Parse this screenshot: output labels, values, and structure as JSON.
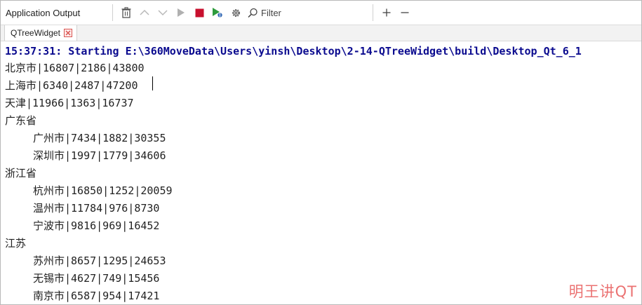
{
  "toolbar": {
    "title": "Application Output",
    "filter_placeholder": "Filter",
    "icons": [
      "trash-icon",
      "arrow-up-icon",
      "arrow-down-icon",
      "run-icon",
      "stop-icon",
      "debug-run-icon",
      "gear-icon",
      "search-icon",
      "plus-icon",
      "minus-icon"
    ],
    "stop_color": "#c8102e",
    "debug_color": "#2e9b3c"
  },
  "tab": {
    "label": "QTreeWidget"
  },
  "output": {
    "start_line": "15:37:31: Starting E:\\360MoveData\\Users\\yinsh\\Desktop\\2-14-QTreeWidget\\build\\Desktop_Qt_6_1",
    "lines": [
      {
        "text": "北京市|16807|2186|43800",
        "indent": false
      },
      {
        "text": "上海市|6340|2487|47200",
        "indent": false
      },
      {
        "text": "天津|11966|1363|16737",
        "indent": false
      },
      {
        "text": "广东省",
        "indent": false
      },
      {
        "text": "广州市|7434|1882|30355",
        "indent": true
      },
      {
        "text": "深圳市|1997|1779|34606",
        "indent": true
      },
      {
        "text": "浙江省",
        "indent": false
      },
      {
        "text": "杭州市|16850|1252|20059",
        "indent": true
      },
      {
        "text": "温州市|11784|976|8730",
        "indent": true
      },
      {
        "text": "宁波市|9816|969|16452",
        "indent": true
      },
      {
        "text": "江苏",
        "indent": false
      },
      {
        "text": "苏州市|8657|1295|24653",
        "indent": true
      },
      {
        "text": "无锡市|4627|749|15456",
        "indent": true
      },
      {
        "text": "南京市|6587|954|17421",
        "indent": true
      }
    ]
  },
  "watermark": "明王讲QT"
}
